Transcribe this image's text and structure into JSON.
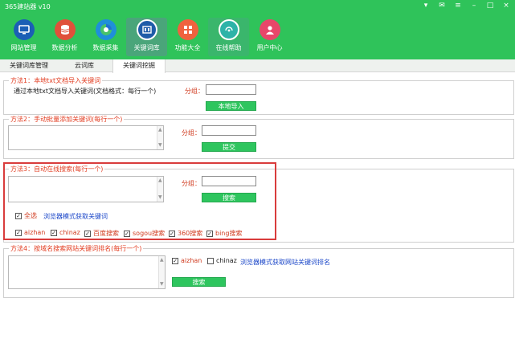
{
  "window": {
    "title": "365建站器 v10",
    "controls": [
      "▾",
      "✉",
      "≡",
      "–",
      "□",
      "×"
    ]
  },
  "toolbar": {
    "items": [
      {
        "label": "网站管理",
        "icon": "monitor-icon",
        "color": "#1b5fb5"
      },
      {
        "label": "数据分析",
        "icon": "database-icon",
        "color": "#e0513a"
      },
      {
        "label": "数据采集",
        "icon": "browser-icon",
        "color": "#1f8fd9"
      },
      {
        "label": "关键词库",
        "icon": "keyword-library-icon",
        "color": "#1f5ca8"
      },
      {
        "label": "功能大全",
        "icon": "apps-grid-icon",
        "color": "#f0623e"
      },
      {
        "label": "在线帮助",
        "icon": "headset-icon",
        "color": "#2db3a8"
      },
      {
        "label": "用户中心",
        "icon": "user-icon",
        "color": "#e8476a"
      }
    ]
  },
  "tabs": [
    {
      "label": "关键词库管理"
    },
    {
      "label": "云词库"
    },
    {
      "label": "关键词挖掘"
    }
  ],
  "method1": {
    "legend": "方法1：本地txt文档导入关键词",
    "desc": "通过本地txt文档导入关键词(文档格式：每行一个)",
    "group_label": "分组：",
    "button": "本地导入"
  },
  "method2": {
    "legend": "方法2：手动批量添加关键词(每行一个)",
    "group_label": "分组：",
    "button": "提交"
  },
  "method3": {
    "legend": "方法3：自动在线搜索(每行一个)",
    "group_label": "分组：",
    "button": "搜索",
    "select_all": "全选",
    "browser_mode": "浏览器模式获取关键词",
    "engines": [
      "aizhan",
      "chinaz",
      "百度搜索",
      "sogou搜索",
      "360搜索",
      "bing搜索"
    ]
  },
  "method4": {
    "legend": "方法4：按域名搜索网站关键词排名(每行一个)",
    "opt1": "aizhan",
    "opt2": "chinaz",
    "browser_mode": "浏览器模式获取网站关键词排名",
    "button": "搜索"
  }
}
